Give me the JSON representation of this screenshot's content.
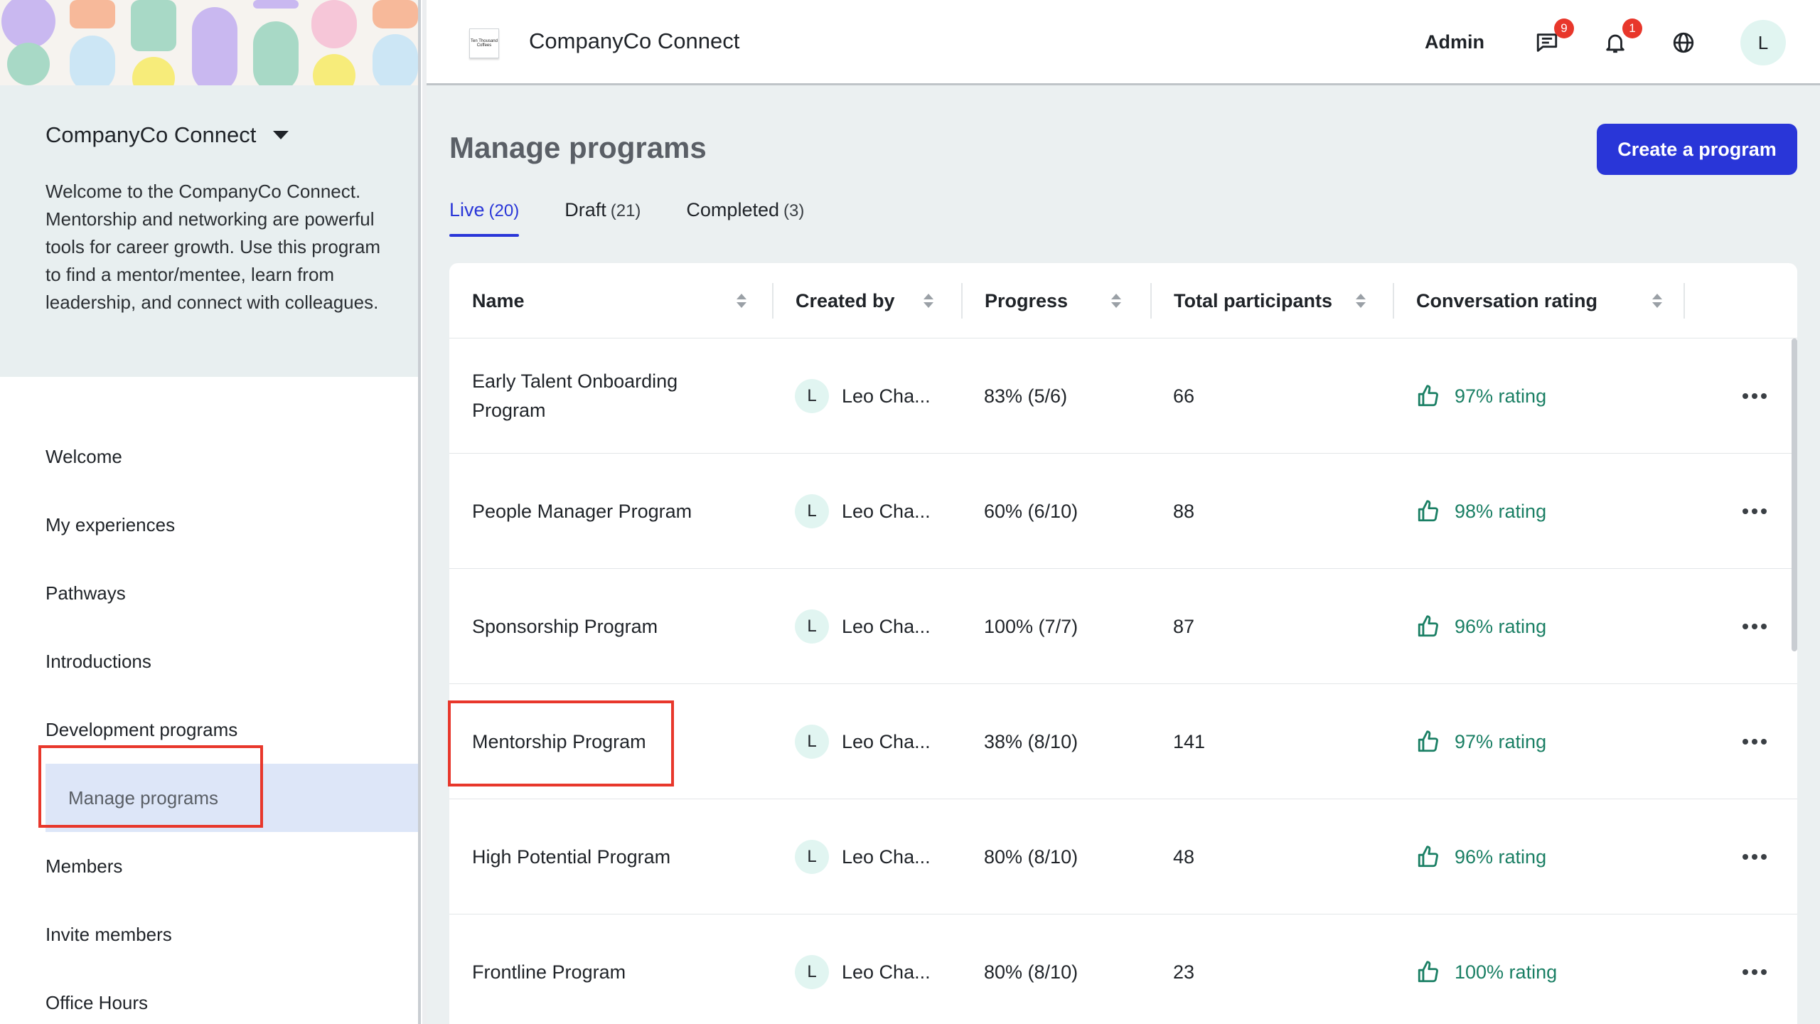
{
  "sidebar": {
    "org_name": "CompanyCo Connect",
    "description": "Welcome to the CompanyCo Connect. Mentorship and networking are powerful tools for career growth. Use this program to find a mentor/mentee, learn from leadership, and connect with colleagues.",
    "items": [
      {
        "label": "Welcome"
      },
      {
        "label": "My experiences"
      },
      {
        "label": "Pathways"
      },
      {
        "label": "Introductions"
      },
      {
        "label": "Development programs"
      },
      {
        "label": "Manage programs"
      },
      {
        "label": "Members"
      },
      {
        "label": "Invite members"
      },
      {
        "label": "Office Hours"
      }
    ]
  },
  "topbar": {
    "logo_text": "Ten Thousand Coffees",
    "app_title": "CompanyCo Connect",
    "admin_label": "Admin",
    "messages_badge": "9",
    "notifications_badge": "1",
    "avatar_initial": "L"
  },
  "page": {
    "title": "Manage programs",
    "create_label": "Create a program",
    "tabs": [
      {
        "label": "Live",
        "count": "(20)"
      },
      {
        "label": "Draft",
        "count": "(21)"
      },
      {
        "label": "Completed",
        "count": "(3)"
      }
    ]
  },
  "table": {
    "columns": [
      "Name",
      "Created by",
      "Progress",
      "Total participants",
      "Conversation rating"
    ],
    "rows": [
      {
        "name": "Early Talent Onboarding Program",
        "initial": "L",
        "creator": "Leo Cha...",
        "progress": "83% (5/6)",
        "participants": "66",
        "rating": "97% rating"
      },
      {
        "name": "People Manager Program",
        "initial": "L",
        "creator": "Leo Cha...",
        "progress": "60% (6/10)",
        "participants": "88",
        "rating": "98% rating"
      },
      {
        "name": "Sponsorship Program",
        "initial": "L",
        "creator": "Leo Cha...",
        "progress": "100% (7/7)",
        "participants": "87",
        "rating": "96% rating"
      },
      {
        "name": "Mentorship Program",
        "initial": "L",
        "creator": "Leo Cha...",
        "progress": "38% (8/10)",
        "participants": "141",
        "rating": "97% rating"
      },
      {
        "name": "High Potential Program",
        "initial": "L",
        "creator": "Leo Cha...",
        "progress": "80% (8/10)",
        "participants": "48",
        "rating": "96% rating"
      },
      {
        "name": "Frontline Program",
        "initial": "L",
        "creator": "Leo Cha...",
        "progress": "80% (8/10)",
        "participants": "23",
        "rating": "100% rating"
      }
    ]
  },
  "colors": {
    "accent": "#2936d8",
    "rating_green": "#1a7f64",
    "highlight_red": "#e8372b",
    "badge_red": "#e8372b"
  }
}
